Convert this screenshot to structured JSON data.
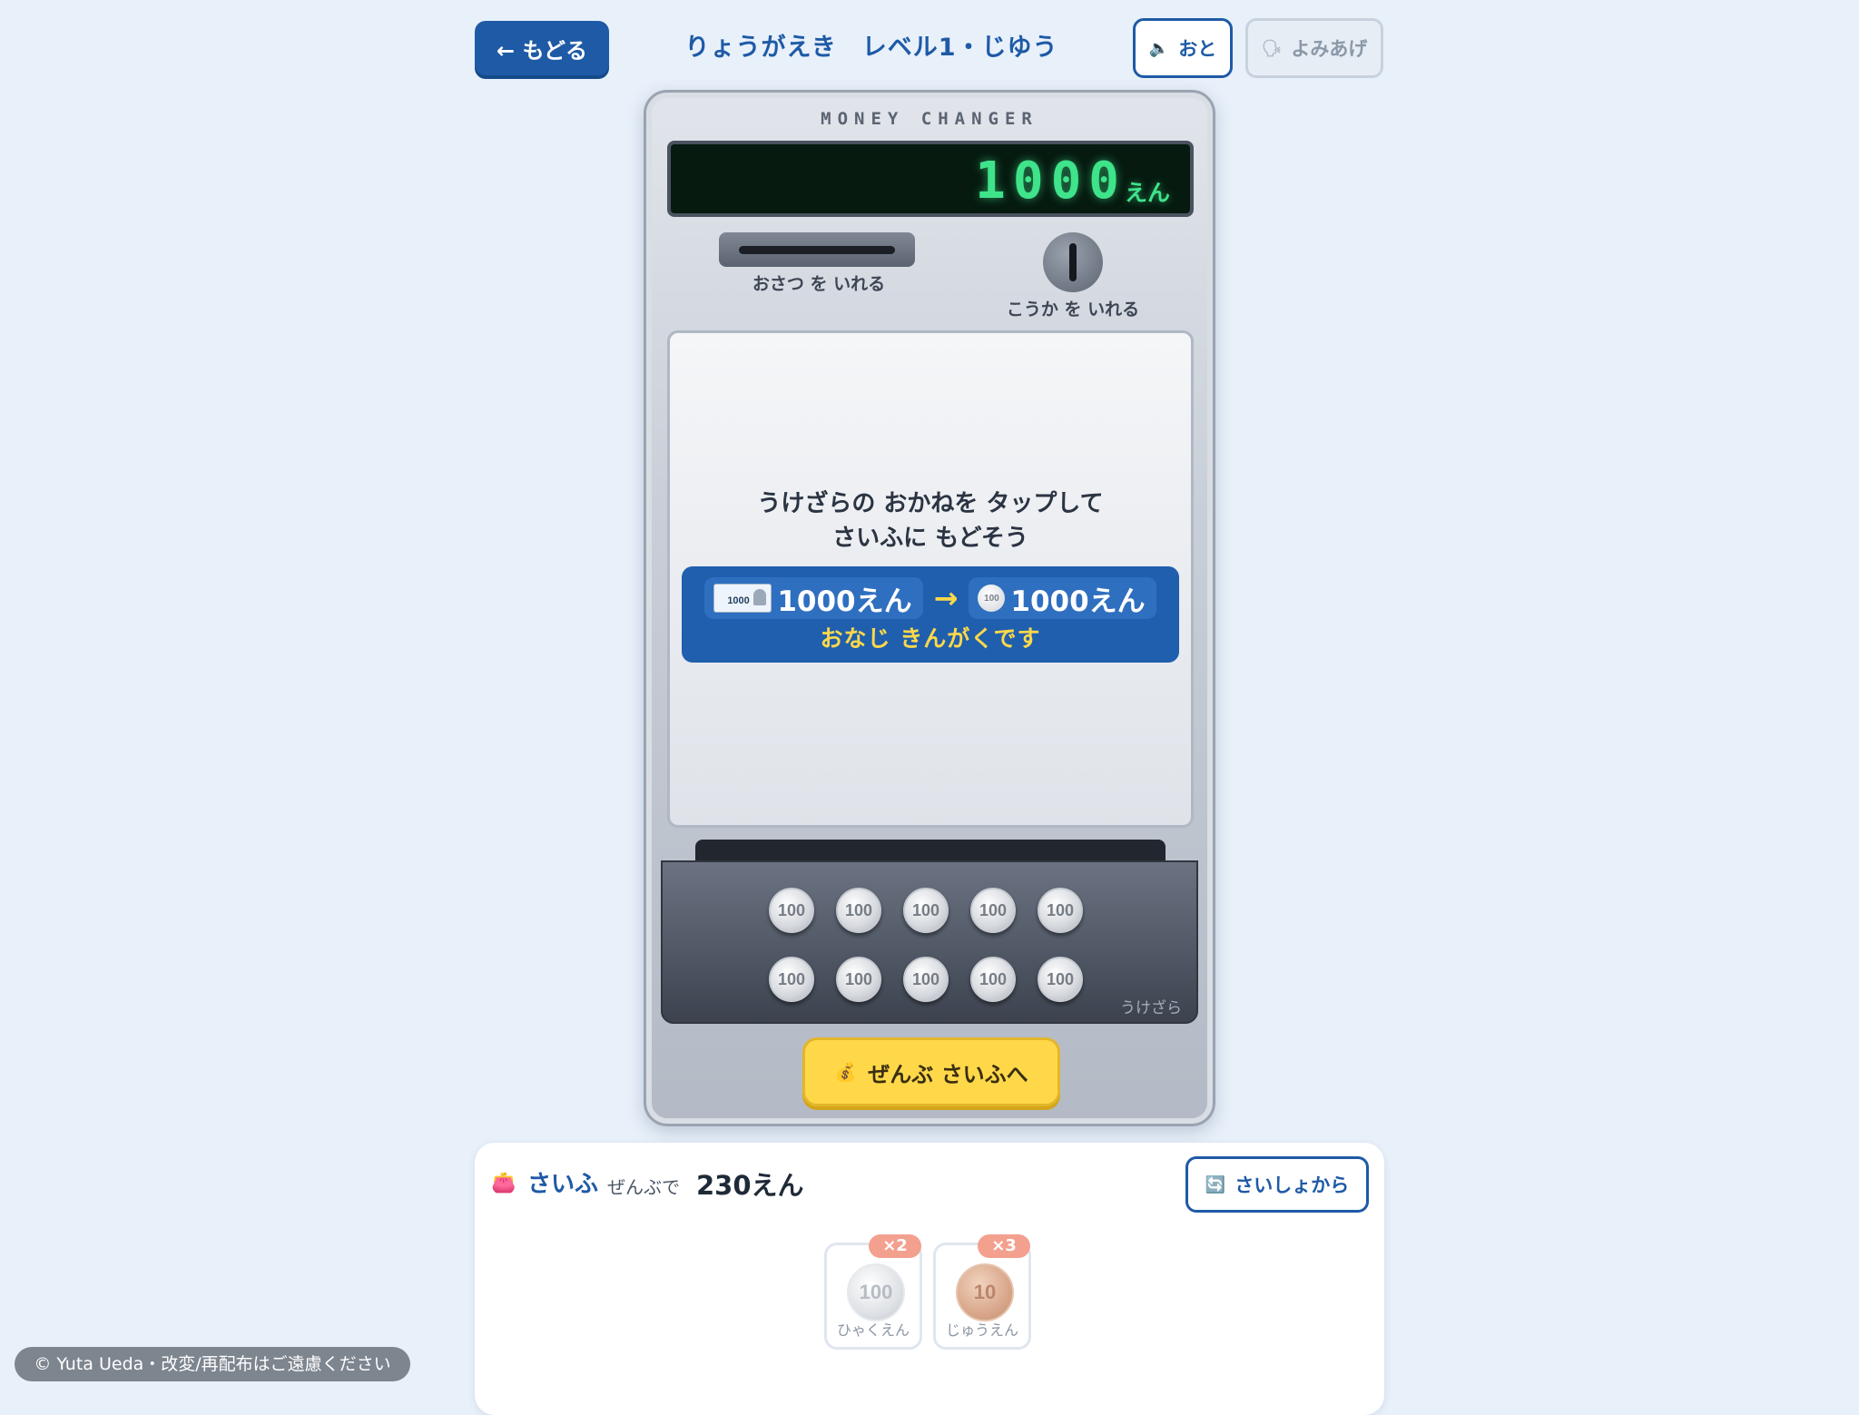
{
  "header": {
    "back_label": "← もどる",
    "title": "りょうがえき　レベル1・じゆう",
    "sound_icon": "🔈",
    "sound_label": "おと",
    "read_icon": "🗣",
    "read_label": "よみあげ"
  },
  "machine": {
    "label": "MONEY CHANGER",
    "display_amount": "1000",
    "display_unit": "えん",
    "bill_slot_label": "おさつ を いれる",
    "coin_slot_label": "こうか を いれる",
    "instruction_line1": "うけざらの おかねを タップして",
    "instruction_line2": "さいふに もどそう",
    "exchange_from": "1000えん",
    "exchange_to": "1000えん",
    "exchange_arrow": "→",
    "exchange_caption": "おなじ きんがくです",
    "bill_icon_text": "1000",
    "coin_icon_text": "100",
    "tray_label": "うけざら",
    "tray_coins": [
      "100",
      "100",
      "100",
      "100",
      "100",
      "100",
      "100",
      "100",
      "100",
      "100"
    ],
    "collect_icon": "💰",
    "collect_label": "ぜんぶ さいふへ"
  },
  "wallet": {
    "icon": "👛",
    "title": "さいふ",
    "subtitle": "ぜんぶで",
    "total": "230えん",
    "restart_icon": "🔄",
    "restart_label": "さいしょから",
    "items": [
      {
        "coin": "100",
        "name": "ひゃくえん",
        "count": "×2"
      },
      {
        "coin": "10",
        "name": "じゅうえん",
        "count": "×3"
      }
    ]
  },
  "footer": {
    "copyright": "© Yuta Ueda・改変/再配布はご遠慮ください"
  },
  "colors": {
    "accent": "#1e5aa6",
    "display_green": "#3fe38a",
    "button_yellow": "#ffd84a",
    "badge": "#f3a08f"
  }
}
